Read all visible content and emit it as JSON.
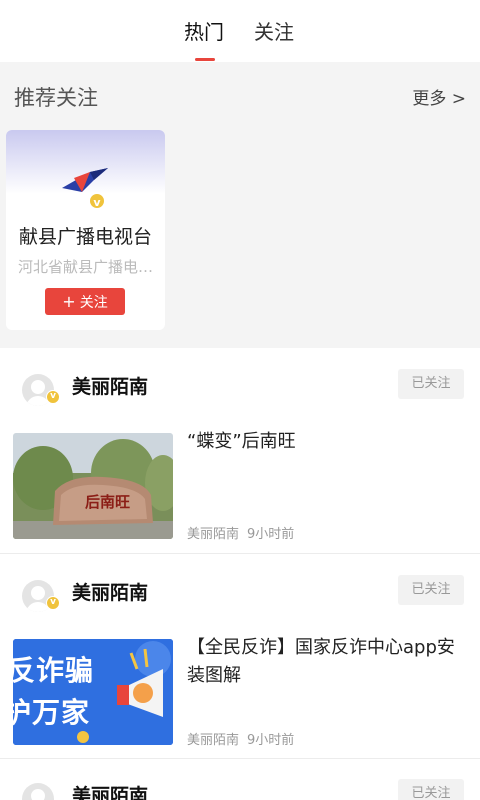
{
  "tabs": [
    {
      "label": "热门",
      "active": true
    },
    {
      "label": "关注",
      "active": false
    }
  ],
  "recommend": {
    "title": "推荐关注",
    "more": "更多 >",
    "card": {
      "name": "献县广播电视台",
      "desc": "河北省献县广播电…",
      "follow_label": "关注",
      "verified_mark": "v"
    }
  },
  "feed": [
    {
      "author": "美丽陌南",
      "follow_status": "已关注",
      "headline": "“蝶变”后南旺",
      "source": "美丽陌南",
      "time": "9小时前",
      "image_text": "后南旺"
    },
    {
      "author": "美丽陌南",
      "follow_status": "已关注",
      "headline": "【全民反诈】国家反诈中心app安装图解",
      "source": "美丽陌南",
      "time": "9小时前",
      "image_text_1": "反诈骗",
      "image_text_2": "护万家"
    },
    {
      "author": "美丽陌南",
      "follow_status": "已关注"
    }
  ],
  "colors": {
    "accent": "#e8453c",
    "verified": "#f0c33c",
    "section_bg": "#f4f4f4"
  }
}
